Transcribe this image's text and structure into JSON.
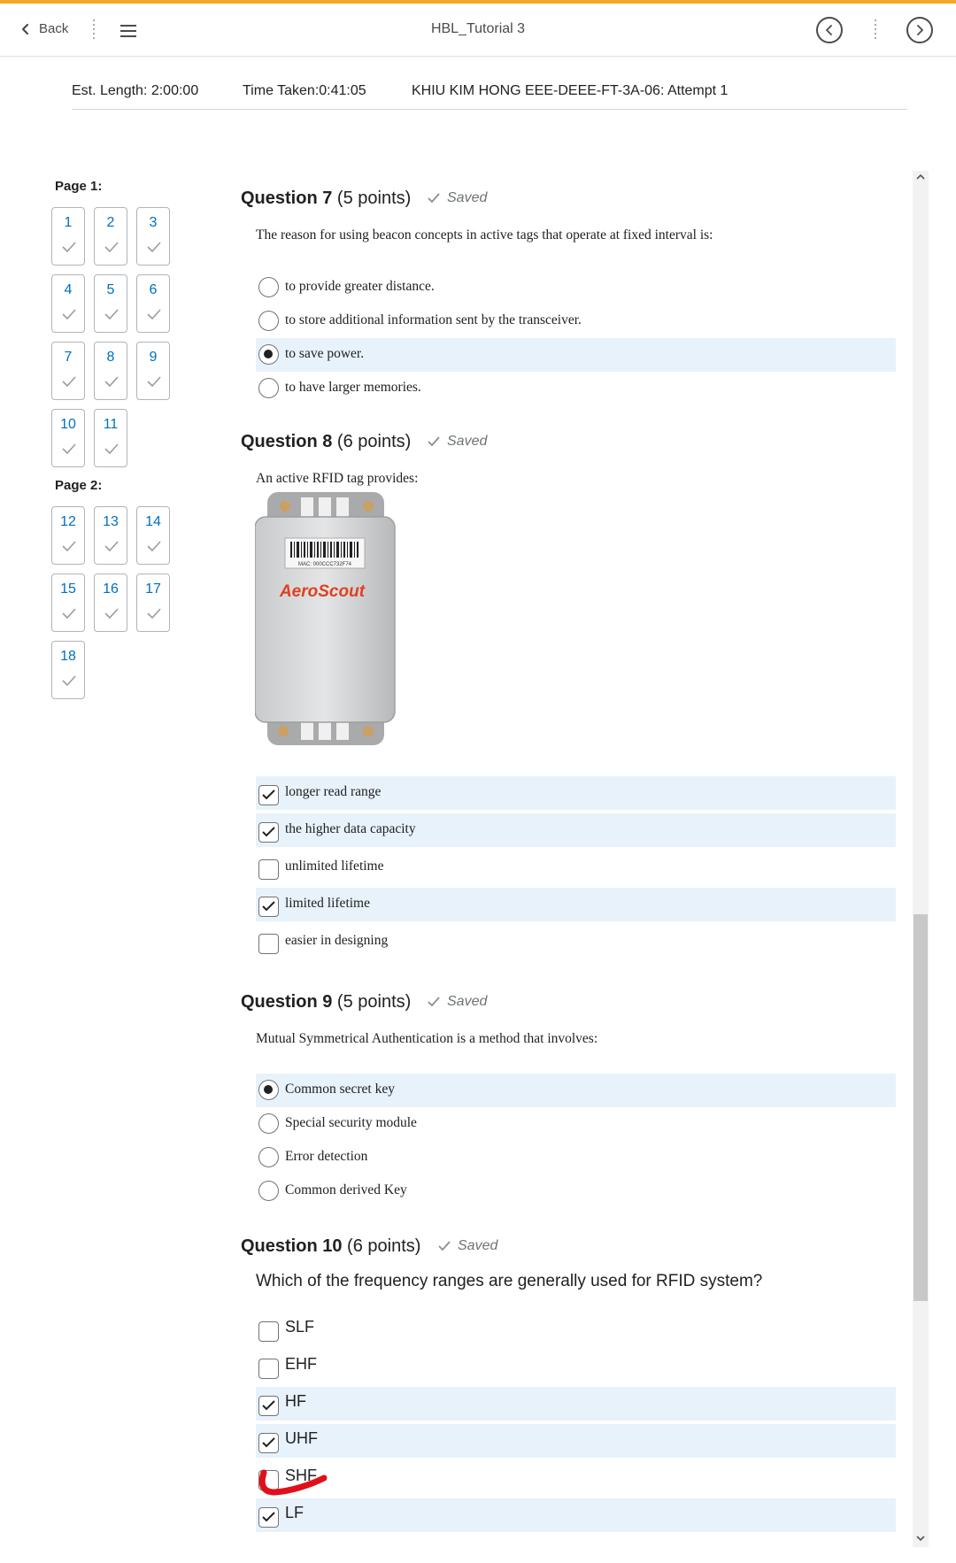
{
  "header": {
    "back_label": "Back",
    "title": "HBL_Tutorial 3"
  },
  "info": {
    "est_length": "Est. Length: 2:00:00",
    "time_taken": "Time Taken:0:41:05",
    "attempt": "KHIU KIM HONG EEE-DEEE-FT-3A-06: Attempt 1"
  },
  "nav": {
    "page1_label": "Page 1:",
    "page2_label": "Page 2:",
    "page1": [
      "1",
      "2",
      "3",
      "4",
      "5",
      "6",
      "7",
      "8",
      "9",
      "10",
      "11"
    ],
    "page2": [
      "12",
      "13",
      "14",
      "15",
      "16",
      "17",
      "18"
    ]
  },
  "q7": {
    "number": "Question 7",
    "points": "(5 points)",
    "saved": "Saved",
    "text": "The reason for using beacon concepts in active tags that operate at fixed interval is:",
    "options": [
      "to provide greater distance.",
      "to store additional information sent by the transceiver.",
      "to save power.",
      "to have larger memories."
    ],
    "selected": 2
  },
  "q8": {
    "number": "Question 8",
    "points": "(6 points)",
    "saved": "Saved",
    "text": "An active RFID tag provides:",
    "image_barcode_text": "MAC: 000CCC732F74",
    "image_brand": "AeroScout",
    "options": [
      "longer read range",
      "the higher data capacity",
      "unlimited lifetime",
      "limited lifetime",
      "easier in designing"
    ],
    "checked": [
      true,
      true,
      false,
      true,
      false
    ]
  },
  "q9": {
    "number": "Question 9",
    "points": "(5 points)",
    "saved": "Saved",
    "text": "Mutual Symmetrical Authentication is a method that involves:",
    "options": [
      "Common secret key",
      "Special security module",
      "Error detection",
      "Common derived Key"
    ],
    "selected": 0
  },
  "q10": {
    "number": "Question 10",
    "points": "(6 points)",
    "saved": "Saved",
    "text": "Which of the frequency ranges are generally used for RFID system?",
    "options": [
      "SLF",
      "EHF",
      "HF",
      "UHF",
      "SHF",
      "LF"
    ],
    "checked": [
      false,
      false,
      true,
      true,
      false,
      true
    ]
  },
  "colors": {
    "accent_top": "#f6a623",
    "link": "#006fbf",
    "selected_bg": "#e8f2fb",
    "annotation": "#e0101a"
  }
}
